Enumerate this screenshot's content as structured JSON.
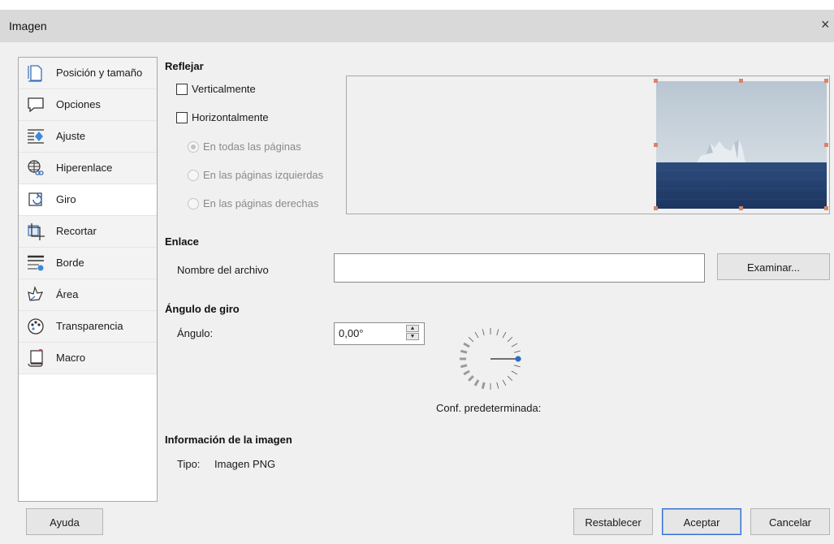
{
  "window": {
    "title": "Imagen",
    "close_glyph": "×"
  },
  "sidebar": {
    "items": [
      {
        "label": "Posición y tamaño",
        "icon": "position-size-icon"
      },
      {
        "label": "Opciones",
        "icon": "options-icon"
      },
      {
        "label": "Ajuste",
        "icon": "wrap-icon"
      },
      {
        "label": "Hiperenlace",
        "icon": "hyperlink-icon"
      },
      {
        "label": "Giro",
        "icon": "rotation-icon",
        "selected": true
      },
      {
        "label": "Recortar",
        "icon": "crop-icon"
      },
      {
        "label": "Borde",
        "icon": "border-icon"
      },
      {
        "label": "Área",
        "icon": "area-icon"
      },
      {
        "label": "Transparencia",
        "icon": "transparency-icon"
      },
      {
        "label": "Macro",
        "icon": "macro-icon"
      }
    ]
  },
  "flip": {
    "heading": "Reflejar",
    "vertical_label": "Verticalmente",
    "horizontal_label": "Horizontalmente",
    "vertical_checked": false,
    "horizontal_checked": false,
    "options": [
      {
        "label": "En todas las páginas",
        "selected": true
      },
      {
        "label": "En las páginas izquierdas",
        "selected": false
      },
      {
        "label": "En las páginas derechas",
        "selected": false
      }
    ]
  },
  "link": {
    "heading": "Enlace",
    "filename_label": "Nombre del archivo",
    "filename_value": "",
    "browse_label": "Examinar..."
  },
  "rotation": {
    "heading": "Ángulo de giro",
    "angle_label": "Ángulo:",
    "angle_value": "0,00°",
    "default_label": "Conf. predeterminada:"
  },
  "image_info": {
    "heading": "Información de la imagen",
    "type_label": "Tipo:",
    "type_value": "Imagen PNG"
  },
  "buttons": {
    "help": "Ayuda",
    "reset": "Restablecer",
    "ok": "Aceptar",
    "cancel": "Cancelar"
  },
  "colors": {
    "titlebar": "#d9d9d9",
    "dialog_bg": "#f0f0f0",
    "handle": "#d8856a",
    "dial_knob": "#2a6cc6"
  }
}
